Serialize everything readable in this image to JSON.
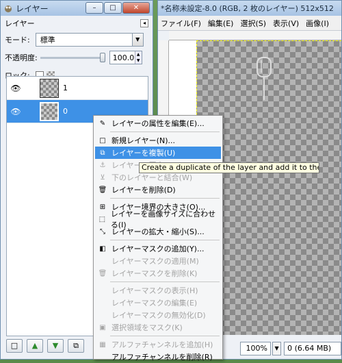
{
  "layers_window": {
    "title": "レイヤー",
    "panel_label": "レイヤー",
    "mode_label": "モード:",
    "mode_value": "標準",
    "opacity_label": "不透明度:",
    "opacity_value": "100.0",
    "lock_label": "ロック:",
    "layers": [
      {
        "name": "1",
        "selected": false
      },
      {
        "name": "0",
        "selected": true
      }
    ]
  },
  "image_window": {
    "title": "*名称未設定-8.0 (RGB, 2 枚のレイヤー) 512x512",
    "menus": [
      "ファイル(F)",
      "編集(E)",
      "選択(S)",
      "表示(V)",
      "画像(I)"
    ],
    "zoom": "100%",
    "status": "0 (6.64 MB)"
  },
  "context_menu": {
    "items": [
      {
        "label": "レイヤーの属性を編集(E)...",
        "icon": "edit-icon",
        "disabled": false
      },
      {
        "sep": true
      },
      {
        "label": "新規レイヤー(N)...",
        "icon": "new-layer-icon",
        "disabled": false
      },
      {
        "label": "レイヤーを複製(U)",
        "icon": "duplicate-icon",
        "disabled": false,
        "highlighted": true
      },
      {
        "label": "レイヤーの固定(A)",
        "icon": "anchor-icon",
        "disabled": true
      },
      {
        "label": "下のレイヤーと結合(W)",
        "icon": "merge-icon",
        "disabled": true
      },
      {
        "label": "レイヤーを削除(D)",
        "icon": "delete-icon",
        "disabled": false
      },
      {
        "sep": true
      },
      {
        "label": "レイヤー境界の大きさ(O)...",
        "icon": "boundary-icon",
        "disabled": false
      },
      {
        "label": "レイヤーを画像サイズに合わせる(I)",
        "icon": "fit-icon",
        "disabled": false
      },
      {
        "label": "レイヤーの拡大・縮小(S)...",
        "icon": "scale-icon",
        "disabled": false
      },
      {
        "sep": true
      },
      {
        "label": "レイヤーマスクの追加(Y)...",
        "icon": "mask-add-icon",
        "disabled": false
      },
      {
        "label": "レイヤーマスクの適用(M)",
        "icon": "",
        "disabled": true
      },
      {
        "label": "レイヤーマスクを削除(K)",
        "icon": "mask-delete-icon",
        "disabled": true
      },
      {
        "sep": true
      },
      {
        "label": "レイヤーマスクの表示(H)",
        "icon": "",
        "disabled": true
      },
      {
        "label": "レイヤーマスクの編集(E)",
        "icon": "",
        "disabled": true
      },
      {
        "label": "レイヤーマスクの無効化(D)",
        "icon": "",
        "disabled": true
      },
      {
        "label": "選択領域をマスク(K)",
        "icon": "mask-select-icon",
        "disabled": true
      },
      {
        "sep": true
      },
      {
        "label": "アルファチャンネルを追加(H)",
        "icon": "alpha-icon",
        "disabled": true
      },
      {
        "label": "アルファチャンネルを削除(R)",
        "icon": "",
        "disabled": false
      }
    ]
  },
  "tooltip": "Create a duplicate of the layer and add it to the image"
}
